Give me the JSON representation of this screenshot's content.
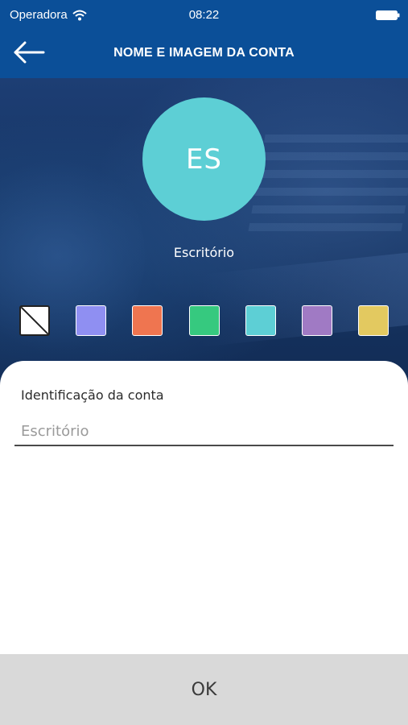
{
  "status_bar": {
    "carrier": "Operadora",
    "time": "08:22",
    "wifi_icon": "wifi-icon",
    "battery_icon": "battery-icon"
  },
  "header": {
    "title": "NOME E IMAGEM DA CONTA",
    "back_icon": "arrow-left-icon",
    "background_color": "#0b4f98"
  },
  "avatar": {
    "initials": "ES",
    "name": "Escritório",
    "color": "#5dcfd5"
  },
  "swatches": [
    {
      "name": "none",
      "color": "#ffffff"
    },
    {
      "name": "periwinkle",
      "color": "#8f8ff2"
    },
    {
      "name": "coral",
      "color": "#ef7550"
    },
    {
      "name": "green",
      "color": "#36c97f"
    },
    {
      "name": "cyan",
      "color": "#5dcfd5"
    },
    {
      "name": "purple",
      "color": "#a07ac4"
    },
    {
      "name": "yellow",
      "color": "#e3c960"
    }
  ],
  "form": {
    "label": "Identificação da conta",
    "placeholder": "Escritório",
    "value": ""
  },
  "ok_button": {
    "label": "OK"
  }
}
